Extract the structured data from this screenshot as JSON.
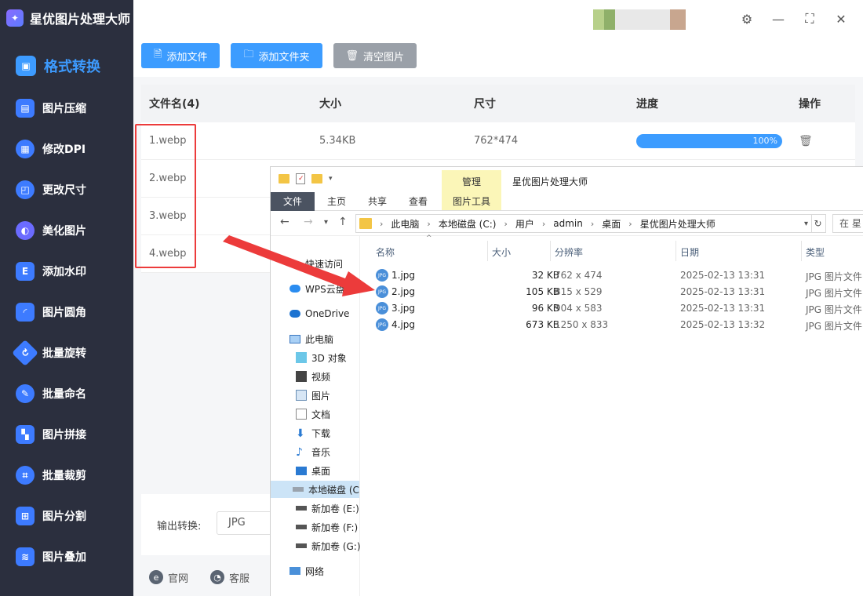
{
  "app": {
    "title": "星优图片处理大师",
    "window_controls": {
      "settings": "⚙",
      "minimize": "—",
      "maximize": "⛶",
      "close": "✕"
    }
  },
  "sidebar": {
    "items": [
      {
        "label": "格式转换",
        "icon": "image-convert-icon",
        "color": "#3d9bff",
        "active": true
      },
      {
        "label": "图片压缩",
        "icon": "compress-icon",
        "color": "#3d7bff"
      },
      {
        "label": "修改DPI",
        "icon": "dpi-icon",
        "color": "#3d7bff"
      },
      {
        "label": "更改尺寸",
        "icon": "resize-icon",
        "color": "#3d7bff"
      },
      {
        "label": "美化图片",
        "icon": "beautify-icon",
        "color": "#6b6bff"
      },
      {
        "label": "添加水印",
        "icon": "watermark-icon",
        "color": "#3d7bff"
      },
      {
        "label": "图片圆角",
        "icon": "round-corner-icon",
        "color": "#3d7bff"
      },
      {
        "label": "批量旋转",
        "icon": "rotate-icon",
        "color": "#3d7bff"
      },
      {
        "label": "批量命名",
        "icon": "rename-icon",
        "color": "#3d7bff"
      },
      {
        "label": "图片拼接",
        "icon": "stitch-icon",
        "color": "#3d7bff"
      },
      {
        "label": "批量裁剪",
        "icon": "crop-icon",
        "color": "#3d7bff"
      },
      {
        "label": "图片分割",
        "icon": "split-icon",
        "color": "#3d7bff"
      },
      {
        "label": "图片叠加",
        "icon": "overlay-icon",
        "color": "#3d7bff"
      }
    ]
  },
  "toolbar": {
    "add_file": "添加文件",
    "add_folder": "添加文件夹",
    "clear": "清空图片"
  },
  "table": {
    "headers": [
      "文件名(4)",
      "大小",
      "尺寸",
      "进度",
      "操作"
    ],
    "rows": [
      {
        "name": "1.webp",
        "size": "5.34KB",
        "dims": "762*474",
        "progress": "100%"
      },
      {
        "name": "2.webp"
      },
      {
        "name": "3.webp"
      },
      {
        "name": "4.webp"
      }
    ]
  },
  "output": {
    "label": "输出转换:",
    "format": "JPG"
  },
  "footer": {
    "website": "官网",
    "support": "客服"
  },
  "explorer": {
    "manage_tab": "管理",
    "title": "星优图片处理大师",
    "ribbon_tabs": [
      "文件",
      "主页",
      "共享",
      "查看",
      "图片工具"
    ],
    "path": [
      "此电脑",
      "本地磁盘 (C:)",
      "用户",
      "admin",
      "桌面",
      "星优图片处理大师"
    ],
    "search_placeholder": "在 星",
    "nav": [
      {
        "label": "快速访问",
        "icon": "star-icon"
      },
      {
        "label": "WPS云盘",
        "icon": "cloud-icon"
      },
      {
        "label": "OneDrive",
        "icon": "onedrive-icon"
      },
      {
        "label": "此电脑",
        "icon": "pc-icon"
      },
      {
        "label": "3D 对象",
        "icon": "3d-icon"
      },
      {
        "label": "视频",
        "icon": "video-icon"
      },
      {
        "label": "图片",
        "icon": "picture-icon"
      },
      {
        "label": "文档",
        "icon": "document-icon"
      },
      {
        "label": "下载",
        "icon": "download-icon"
      },
      {
        "label": "音乐",
        "icon": "music-icon"
      },
      {
        "label": "桌面",
        "icon": "desktop-icon"
      },
      {
        "label": "本地磁盘 (C",
        "icon": "drive-icon",
        "selected": true
      },
      {
        "label": "新加卷 (E:)",
        "icon": "drive-icon"
      },
      {
        "label": "新加卷 (F:)",
        "icon": "drive-icon"
      },
      {
        "label": "新加卷 (G:)",
        "icon": "drive-icon"
      },
      {
        "label": "网络",
        "icon": "network-icon"
      }
    ],
    "columns": [
      "名称",
      "大小",
      "分辨率",
      "日期",
      "类型"
    ],
    "files": [
      {
        "name": "1.jpg",
        "size": "32 KB",
        "resolution": "762 x 474",
        "date": "2025-02-13 13:31",
        "type": "JPG 图片文件"
      },
      {
        "name": "2.jpg",
        "size": "105 KB",
        "resolution": "815 x 529",
        "date": "2025-02-13 13:31",
        "type": "JPG 图片文件"
      },
      {
        "name": "3.jpg",
        "size": "96 KB",
        "resolution": "904 x 583",
        "date": "2025-02-13 13:31",
        "type": "JPG 图片文件"
      },
      {
        "name": "4.jpg",
        "size": "673 KB",
        "resolution": "1250 x 833",
        "date": "2025-02-13 13:32",
        "type": "JPG 图片文件"
      }
    ]
  }
}
